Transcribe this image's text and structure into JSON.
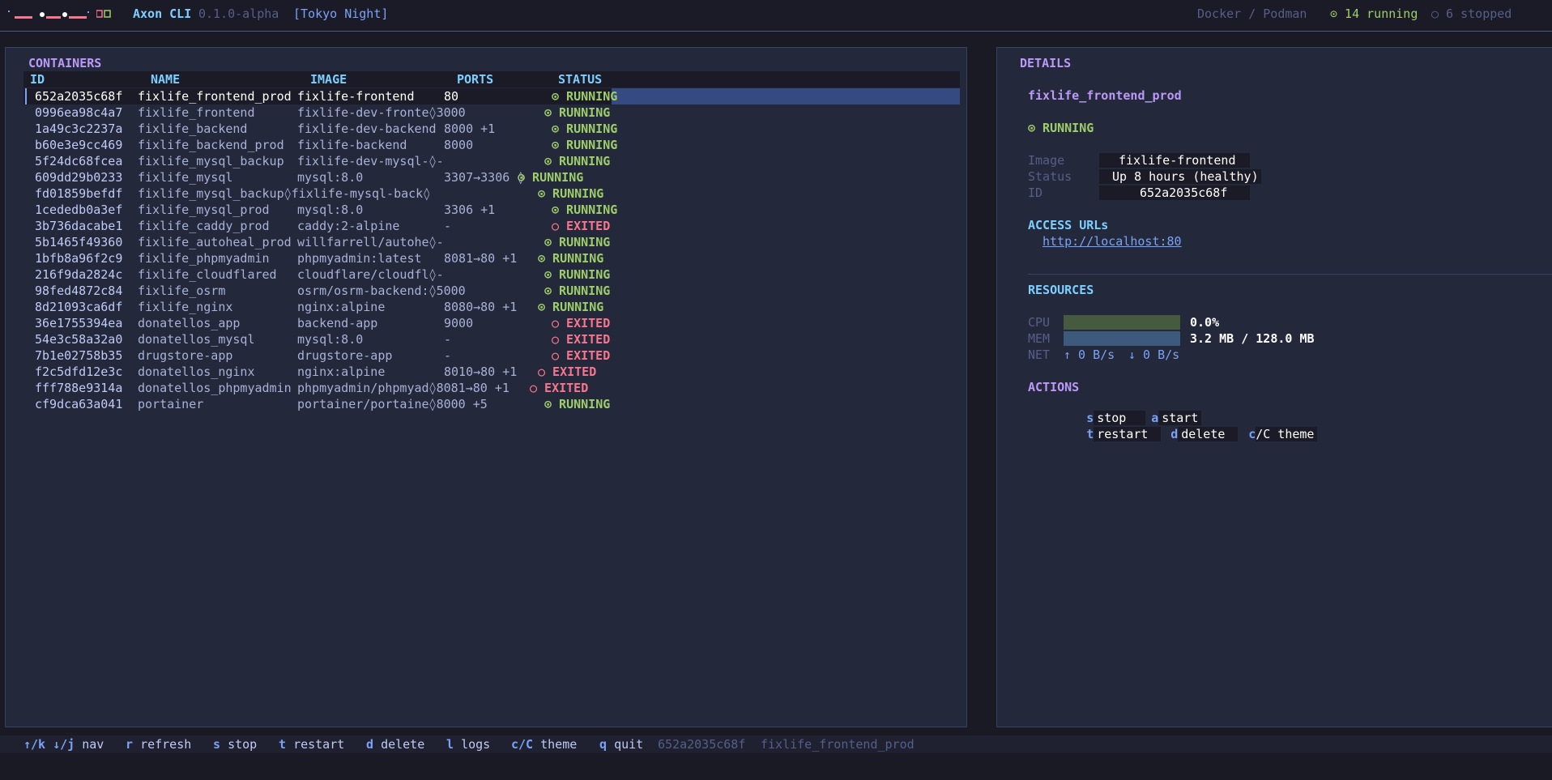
{
  "topbar": {
    "logo_icon": "axon-logo-icon",
    "title": "Axon CLI",
    "version": "0.1.0-alpha",
    "theme": "[Tokyo Night]",
    "engine": "Docker / Podman",
    "running": "⊙ 14 running",
    "stopped": "○ 6 stopped"
  },
  "containers": {
    "title": "CONTAINERS",
    "columns": {
      "id": "ID",
      "name": "NAME",
      "image": "IMAGE",
      "ports": "PORTS",
      "status": "STATUS"
    },
    "rows": [
      {
        "id": "652a2035c68f",
        "name": "fixlife_frontend_prod",
        "image": "fixlife-frontend",
        "ports": "80",
        "status": "⊙ RUNNING",
        "state": "running"
      },
      {
        "id": "0996ea98c4a7",
        "name": "fixlife_frontend",
        "image": "fixlife-dev-fronte◊3000",
        "ports": "",
        "status": "⊙ RUNNING",
        "state": "running"
      },
      {
        "id": "1a49c3c2237a",
        "name": "fixlife_backend",
        "image": "fixlife-dev-backend",
        "ports": "8000 +1",
        "status": "⊙ RUNNING",
        "state": "running"
      },
      {
        "id": "b60e3e9cc469",
        "name": "fixlife_backend_prod",
        "image": "fixlife-backend",
        "ports": "8000",
        "status": "⊙ RUNNING",
        "state": "running"
      },
      {
        "id": "5f24dc68fcea",
        "name": "fixlife_mysql_backup",
        "image": "fixlife-dev-mysql-◊-",
        "ports": "",
        "status": "⊙ RUNNING",
        "state": "running"
      },
      {
        "id": "609dd29b0233",
        "name": "fixlife_mysql",
        "image": "mysql:8.0",
        "ports": "3307→3306 ◊",
        "status": "⊙ RUNNING",
        "state": "running"
      },
      {
        "id": "fd01859befdf",
        "name": "fixlife_mysql_backup◊fixlife-mysql-back◊-",
        "image": "",
        "ports": "",
        "status": "⊙ RUNNING",
        "state": "running"
      },
      {
        "id": "1cededb0a3ef",
        "name": "fixlife_mysql_prod",
        "image": "mysql:8.0",
        "ports": "3306 +1",
        "status": "⊙ RUNNING",
        "state": "running"
      },
      {
        "id": "3b736dacabe1",
        "name": "fixlife_caddy_prod",
        "image": "caddy:2-alpine",
        "ports": "-",
        "status": "○ EXITED",
        "state": "exited"
      },
      {
        "id": "5b1465f49360",
        "name": "fixlife_autoheal_prod",
        "image": "willfarrell/autohe◊-",
        "ports": "",
        "status": "⊙ RUNNING",
        "state": "running"
      },
      {
        "id": "1bfb8a96f2c9",
        "name": "fixlife_phpmyadmin",
        "image": "phpmyadmin:latest",
        "ports": "8081→80 +1",
        "status": "⊙ RUNNING",
        "state": "running"
      },
      {
        "id": "216f9da2824c",
        "name": "fixlife_cloudflared",
        "image": "cloudflare/cloudfl◊-",
        "ports": "",
        "status": "⊙ RUNNING",
        "state": "running"
      },
      {
        "id": "98fed4872c84",
        "name": "fixlife_osrm",
        "image": "osrm/osrm-backend:◊5000",
        "ports": "",
        "status": "⊙ RUNNING",
        "state": "running"
      },
      {
        "id": "8d21093ca6df",
        "name": "fixlife_nginx",
        "image": "nginx:alpine",
        "ports": "8080→80 +1",
        "status": "⊙ RUNNING",
        "state": "running"
      },
      {
        "id": "36e1755394ea",
        "name": "donatellos_app",
        "image": "backend-app",
        "ports": "9000",
        "status": "○ EXITED",
        "state": "exited"
      },
      {
        "id": "54e3c58a32a0",
        "name": "donatellos_mysql",
        "image": "mysql:8.0",
        "ports": "-",
        "status": "○ EXITED",
        "state": "exited"
      },
      {
        "id": "7b1e02758b35",
        "name": "drugstore-app",
        "image": "drugstore-app",
        "ports": "-",
        "status": "○ EXITED",
        "state": "exited"
      },
      {
        "id": "f2c5dfd12e3c",
        "name": "donatellos_nginx",
        "image": "nginx:alpine",
        "ports": "8010→80 +1",
        "status": "○ EXITED",
        "state": "exited"
      },
      {
        "id": "fff788e9314a",
        "name": "donatellos_phpmyadmin",
        "image": "phpmyadmin/phpmyad◊8081→80 +1",
        "ports": "",
        "status": "○ EXITED",
        "state": "exited"
      },
      {
        "id": "cf9dca63a041",
        "name": "portainer",
        "image": "portainer/portaine◊8000 +5",
        "ports": "",
        "status": "⊙ RUNNING",
        "state": "running"
      }
    ]
  },
  "details": {
    "title": "DETAILS",
    "name": "fixlife_frontend_prod",
    "status": "⊙ RUNNING",
    "image_label": "Image",
    "image_value": "fixlife-frontend",
    "status_label": "Status",
    "status_value": "Up 8 hours (healthy)",
    "id_label": "ID",
    "id_value": "652a2035c68f",
    "access_title": "ACCESS URLs",
    "access_url": "http://localhost:80",
    "resources_title": "RESOURCES",
    "cpu_label": "CPU",
    "cpu_value": "0.0%",
    "mem_label": "MEM",
    "mem_value": "3.2 MB / 128.0 MB",
    "net_label": "NET",
    "net_up": "↑ 0 B/s",
    "net_down": "↓ 0 B/s",
    "actions_title": "ACTIONS",
    "actions": [
      {
        "key": "s",
        "label": "stop"
      },
      {
        "key": "a",
        "label": "start"
      },
      {
        "key": "t",
        "label": "restart"
      },
      {
        "key": "d",
        "label": "delete"
      },
      {
        "key": "c",
        "label": "/C theme"
      }
    ]
  },
  "footer": {
    "nav_key": "↑/k ↓/j",
    "nav_label": "nav",
    "refresh_key": "r",
    "refresh_label": "refresh",
    "stop_key": "s",
    "stop_label": "stop",
    "restart_key": "t",
    "restart_label": "restart",
    "delete_key": "d",
    "delete_label": "delete",
    "logs_key": "l",
    "logs_label": "logs",
    "theme_key": "c/C",
    "theme_label": "theme",
    "quit_key": "q",
    "quit_label": "quit",
    "selected_id": "652a2035c68f",
    "selected_name": "fixlife_frontend_prod"
  }
}
